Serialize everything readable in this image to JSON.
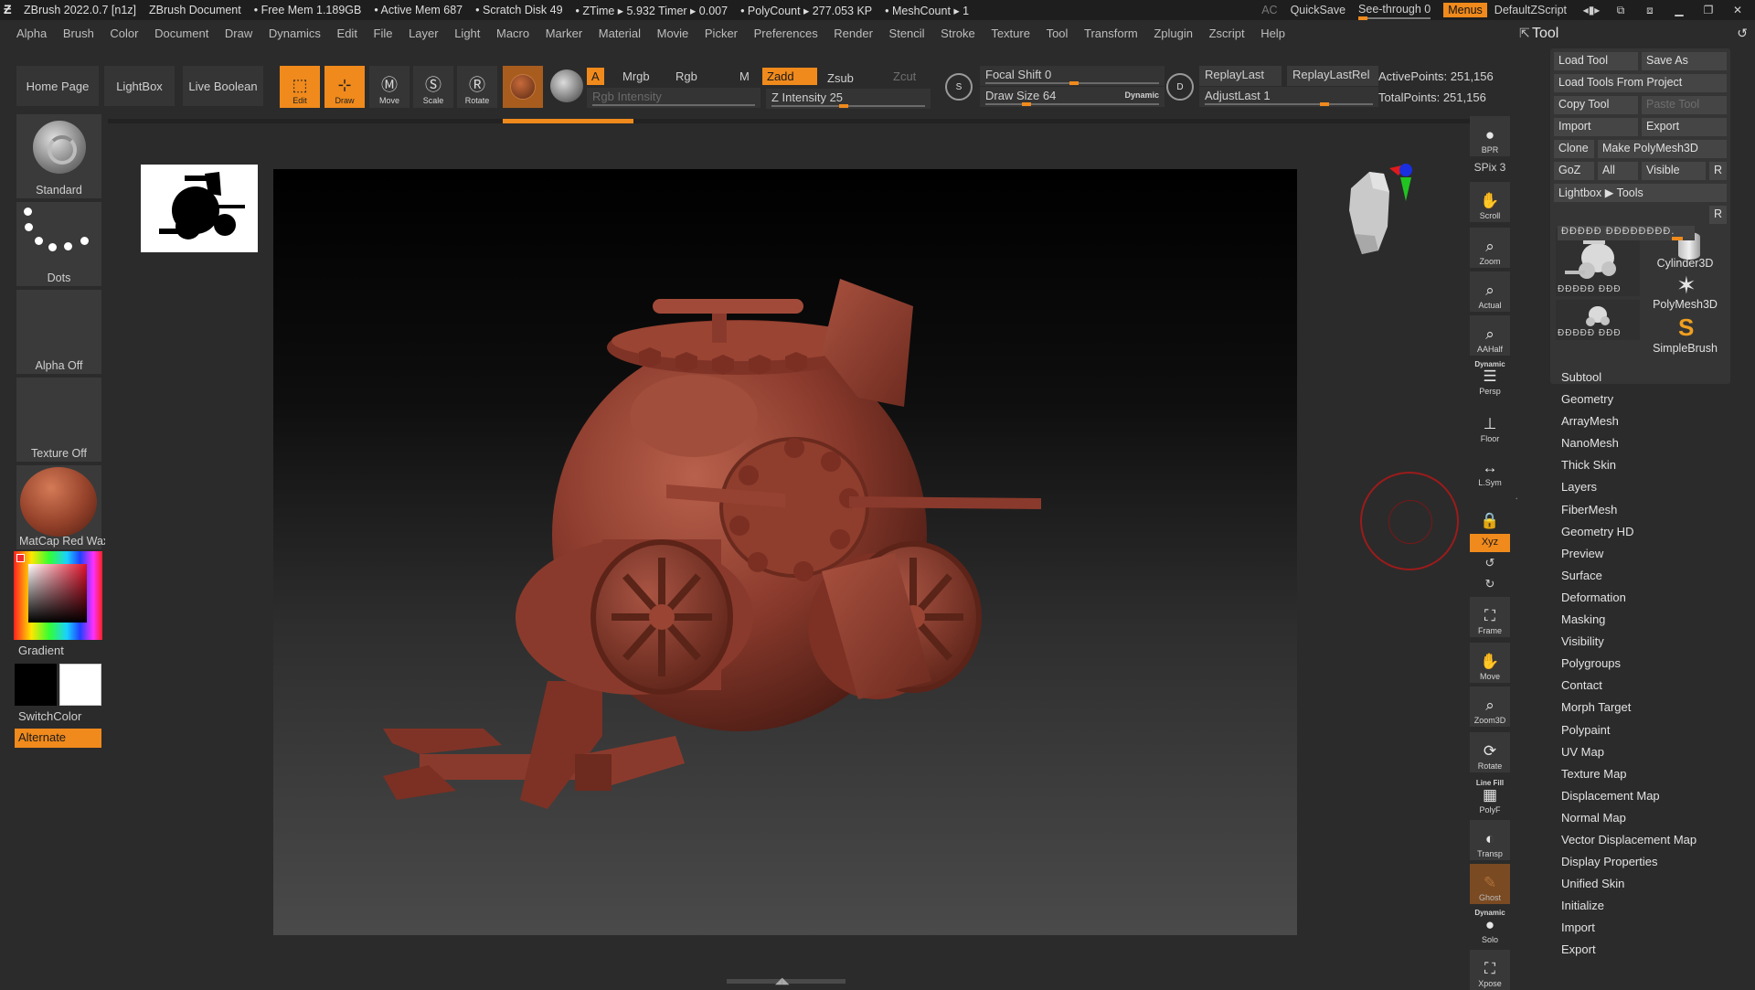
{
  "titlebar": {
    "app": "ZBrush 2022.0.7 [n1z]",
    "document": "ZBrush Document",
    "free_mem": "• Free Mem 1.189GB",
    "active_mem": "• Active Mem 687",
    "scratch_disk": "• Scratch Disk 49",
    "ztime": "• ZTime ▸ 5.932 Timer ▸ 0.007",
    "polycount": "• PolyCount ▸ 277.053 KP",
    "meshcount": "• MeshCount ▸ 1",
    "ac": "AC",
    "quicksave": "QuickSave",
    "see_through": "See-through  0",
    "menus": "Menus",
    "default_zscript": "DefaultZScript"
  },
  "menubar": [
    "Alpha",
    "Brush",
    "Color",
    "Document",
    "Draw",
    "Dynamics",
    "Edit",
    "File",
    "Layer",
    "Light",
    "Macro",
    "Marker",
    "Material",
    "Movie",
    "Picker",
    "Preferences",
    "Render",
    "Stencil",
    "Stroke",
    "Texture",
    "Tool",
    "Transform",
    "Zplugin",
    "Zscript",
    "Help"
  ],
  "shelf": {
    "home_page": "Home Page",
    "lightbox": "LightBox",
    "live_boolean": "Live Boolean",
    "edit": "Edit",
    "draw": "Draw",
    "move": "Move",
    "scale": "Scale",
    "rotate": "Rotate",
    "a": "A",
    "mrgb": "Mrgb",
    "rgb": "Rgb",
    "m": "M",
    "rgb_intensity": "Rgb Intensity",
    "zadd": "Zadd",
    "zsub": "Zsub",
    "zcut": "Zcut",
    "z_intensity": "Z Intensity 25",
    "focal_shift": "Focal Shift 0",
    "draw_size": "Draw Size 64",
    "dynamic": "Dynamic",
    "replay_last": "ReplayLast",
    "replay_last_rel": "ReplayLastRel",
    "adjust_last": "AdjustLast 1",
    "active_points": "ActivePoints: 251,156",
    "total_points": "TotalPoints: 251,156",
    "s_label": "S",
    "d_label": "D"
  },
  "left": {
    "standard": "Standard",
    "dots": "Dots",
    "alpha_off": "Alpha Off",
    "texture_off": "Texture Off",
    "matcap": "MatCap Red Wax",
    "gradient": "Gradient",
    "switch_color": "SwitchColor",
    "alternate": "Alternate"
  },
  "rdock": {
    "bpr": "BPR",
    "spix": "SPix 3",
    "scroll": "Scroll",
    "zoom": "Zoom",
    "actual": "Actual",
    "aahalf": "AAHalf",
    "dynamic": "Dynamic",
    "persp": "Persp",
    "floor": "Floor",
    "lsym": "L.Sym",
    "xyz": "Xyz",
    "frame": "Frame",
    "move": "Move",
    "zoom3d": "Zoom3D",
    "rotate": "Rotate",
    "line_fill": "Line Fill",
    "polyf": "PolyF",
    "transp": "Transp",
    "ghost": "Ghost",
    "dynamic2": "Dynamic",
    "solo": "Solo",
    "xpose": "Xpose"
  },
  "tool": {
    "title": "Tool",
    "load_tool": "Load Tool",
    "save_as": "Save As",
    "load_from_project": "Load Tools From Project",
    "copy_tool": "Copy Tool",
    "paste_tool": "Paste Tool",
    "import": "Import",
    "export": "Export",
    "clone": "Clone",
    "make_polymesh": "Make PolyMesh3D",
    "goz": "GoZ",
    "all": "All",
    "visible": "Visible",
    "r": "R",
    "lightbox_tools": "Lightbox ▶ Tools",
    "tool_slider": "ĐĐĐĐĐ ĐĐĐĐĐĐĐĐ.",
    "cylinder": "Cylinder3D",
    "polymesh": "PolyMesh3D",
    "simplebrush": "SimpleBrush",
    "thumb_label1": "ĐĐĐĐĐ ĐĐĐ",
    "thumb_label2": "ĐĐĐĐĐ ĐĐĐ",
    "sections": [
      "Subtool",
      "Geometry",
      "ArrayMesh",
      "NanoMesh",
      "Thick Skin",
      "Layers",
      "FiberMesh",
      "Geometry HD",
      "Preview",
      "Surface",
      "Deformation",
      "Masking",
      "Visibility",
      "Polygroups",
      "Contact",
      "Morph Target",
      "Polypaint",
      "UV Map",
      "Texture Map",
      "Displacement Map",
      "Normal Map",
      "Vector Displacement Map",
      "Display Properties",
      "Unified Skin",
      "Initialize",
      "Import",
      "Export"
    ]
  },
  "colors": {
    "accent": "#f08a1c",
    "model": "#8a3a2c",
    "background": "#2b2b2b"
  }
}
